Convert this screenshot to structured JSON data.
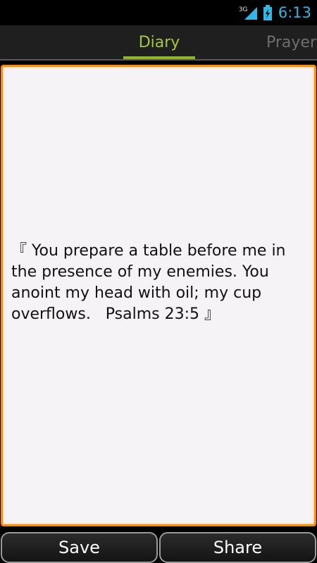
{
  "status_bar": {
    "network_type": "3G",
    "time": "6:13",
    "icons": [
      "signal-icon",
      "battery-charging-icon"
    ]
  },
  "tabs": [
    {
      "label": "Diary",
      "selected": true
    },
    {
      "label": "Prayer",
      "selected": false
    }
  ],
  "editor": {
    "text": "『 You prepare a table before me in the presence of my enemies. You anoint my head with oil; my cup overflows.   Psalms 23:5 』"
  },
  "buttons": {
    "save_label": "Save",
    "share_label": "Share"
  },
  "colors": {
    "accent_tab": "#a4c639",
    "editor_border": "#ff8c00",
    "status_time": "#33b5e5"
  }
}
